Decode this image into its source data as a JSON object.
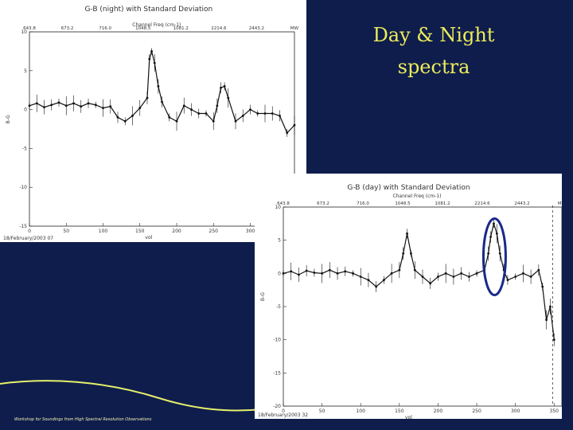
{
  "slide": {
    "title_line1": "Day & Night",
    "title_line2": "spectra",
    "footer": "Workshop for Soundings from High Spectral Resolution Observations",
    "colors": {
      "background": "#0f1d4d",
      "title": "#ecec5a",
      "ellipse": "#1a2a8a",
      "wave": "#e6f06a"
    }
  },
  "chart_data": [
    {
      "type": "line",
      "title": "G-B (night) with Standard Deviation",
      "top_axis_label": "Channel Freq (cm-1)",
      "top_ticks": [
        "643.8",
        "673.2",
        "716.0",
        "1048.5",
        "1081.2",
        "2214.6",
        "2443.2",
        "MW"
      ],
      "xlabel": "vol",
      "ylabel": "B-G",
      "xlim": [
        0,
        360
      ],
      "ylim": [
        -15,
        10
      ],
      "x_ticks": [
        0,
        50,
        100,
        150,
        200,
        250,
        300,
        350
      ],
      "y_ticks": [
        10,
        5,
        0,
        -5,
        -10,
        -15
      ],
      "date": "18/February/2003 07",
      "series": [
        {
          "x": [
            0,
            10,
            20,
            30,
            40,
            50,
            60,
            70,
            80,
            90,
            100,
            110,
            120,
            130,
            140,
            150,
            160,
            163,
            166,
            170,
            175,
            180,
            190,
            200,
            210,
            220,
            230,
            240,
            250,
            255,
            260,
            265,
            270,
            280,
            290,
            300,
            310,
            320,
            330,
            340,
            350,
            360
          ],
          "y": [
            0.5,
            0.8,
            0.3,
            0.6,
            0.9,
            0.5,
            0.8,
            0.4,
            0.8,
            0.6,
            0.2,
            0.4,
            -1.0,
            -1.5,
            -0.8,
            0.2,
            1.5,
            6.5,
            7.5,
            6.0,
            3.0,
            1.0,
            -1.0,
            -1.5,
            0.5,
            0,
            -0.5,
            -0.5,
            -1.5,
            0.5,
            2.8,
            3.0,
            1.5,
            -1.5,
            -0.8,
            0,
            -0.5,
            -0.5,
            -0.5,
            -0.8,
            -3.0,
            -2.0
          ]
        }
      ]
    },
    {
      "type": "line",
      "title": "G-B (day) with Standard Deviation",
      "top_axis_label": "Channel Freq (cm-1)",
      "top_ticks": [
        "643.8",
        "673.2",
        "716.0",
        "1048.5",
        "1081.2",
        "2214.6",
        "2443.2",
        "MW"
      ],
      "xlabel": "vol",
      "ylabel": "B-G",
      "xlim": [
        0,
        360
      ],
      "ylim": [
        -20,
        10
      ],
      "x_ticks": [
        0,
        50,
        100,
        150,
        200,
        250,
        300,
        350
      ],
      "y_ticks": [
        10,
        5,
        0,
        -5,
        -10,
        -15,
        -20
      ],
      "date": "18/February/2003 32",
      "annotation": "ellipse around vol 265-282",
      "series": [
        {
          "x": [
            0,
            10,
            20,
            30,
            40,
            50,
            60,
            70,
            80,
            90,
            100,
            110,
            120,
            130,
            140,
            150,
            155,
            160,
            165,
            170,
            180,
            190,
            200,
            210,
            220,
            230,
            240,
            250,
            260,
            265,
            268,
            272,
            276,
            280,
            285,
            290,
            300,
            310,
            320,
            330,
            335,
            340,
            345,
            350
          ],
          "y": [
            0,
            0.3,
            -0.2,
            0.4,
            0.1,
            0,
            0.5,
            0,
            0.3,
            0,
            -0.5,
            -1,
            -2,
            -1,
            0,
            0.5,
            3,
            6,
            3,
            0.5,
            -0.5,
            -1.5,
            -0.5,
            0,
            -0.5,
            0,
            -0.5,
            0,
            0.5,
            3,
            5.5,
            7.5,
            6,
            3,
            0.5,
            -1,
            -0.5,
            0,
            -0.5,
            0.5,
            -2,
            -7,
            -5,
            -10
          ]
        }
      ]
    }
  ]
}
